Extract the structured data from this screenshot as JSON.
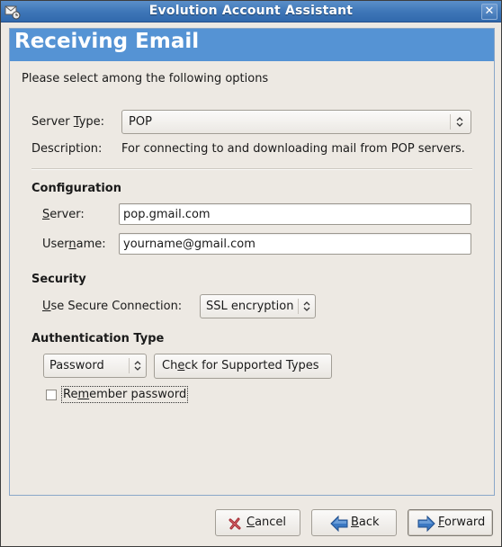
{
  "window": {
    "title": "Evolution Account Assistant",
    "app_icon": "evolution-mail-icon",
    "close_icon": "close-icon"
  },
  "page": {
    "heading": "Receiving Email",
    "intro": "Please select among the following options"
  },
  "server_type": {
    "label_pre": "Server ",
    "label_mnemonic": "T",
    "label_post": "ype:",
    "value": "POP",
    "description_label": "Description:",
    "description": "For connecting to and downloading mail from POP servers."
  },
  "configuration": {
    "heading": "Configuration",
    "server_label_mnemonic": "S",
    "server_label_post": "erver:",
    "server_value": "pop.gmail.com",
    "username_label_pre": "User",
    "username_label_mnemonic": "n",
    "username_label_post": "ame:",
    "username_value": "yourname@gmail.com"
  },
  "security": {
    "heading": "Security",
    "label_mnemonic": "U",
    "label_post": "se Secure Connection:",
    "value": "SSL encryption"
  },
  "authentication": {
    "heading": "Authentication Type",
    "value": "Password",
    "check_button_pre": "Ch",
    "check_button_mnemonic": "e",
    "check_button_post": "ck for Supported Types",
    "remember_pre": "Re",
    "remember_mnemonic": "m",
    "remember_post": "ember password",
    "remember_checked": false
  },
  "buttons": {
    "cancel_mnemonic": "C",
    "cancel_post": "ancel",
    "back_mnemonic": "B",
    "back_post": "ack",
    "forward_mnemonic": "F",
    "forward_post": "orward"
  },
  "colors": {
    "titlebar": "#3f77b8",
    "banner": "#5593d4",
    "background": "#ede9e3",
    "cancel_icon": "#a0262d",
    "arrow_icon": "#3a78c2"
  }
}
